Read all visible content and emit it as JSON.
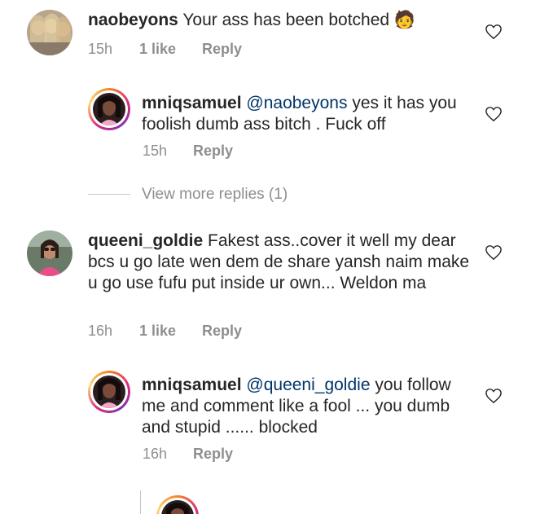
{
  "comments": [
    {
      "username": "naobeyons",
      "text": "Your ass has been botched 🧑",
      "time": "15h",
      "likes": "1 like",
      "reply": "Reply"
    },
    {
      "username": "mniqsamuel",
      "mention": "@naobeyons",
      "text": "yes it has you foolish dumb ass bitch . Fuck off",
      "time": "15h",
      "reply": "Reply"
    },
    {
      "username": "queeni_goldie",
      "text": "Fakest ass..cover it well my dear bcs u go late wen dem de share yansh naim make u go use fufu put inside ur own... Weldon ma",
      "time": "16h",
      "likes": "1 like",
      "reply": "Reply"
    },
    {
      "username": "mniqsamuel",
      "mention": "@queeni_goldie",
      "text": "you follow me and comment like a fool ... you dumb and stupid ...... blocked",
      "time": "16h",
      "reply": "Reply"
    }
  ],
  "view_more_replies": "View more replies (1)",
  "colors": {
    "text": "#262626",
    "meta": "#8e8e8e",
    "mention": "#003569",
    "story_ring": "#dd2a7b"
  },
  "icons": {
    "like": "heart-outline-icon"
  }
}
